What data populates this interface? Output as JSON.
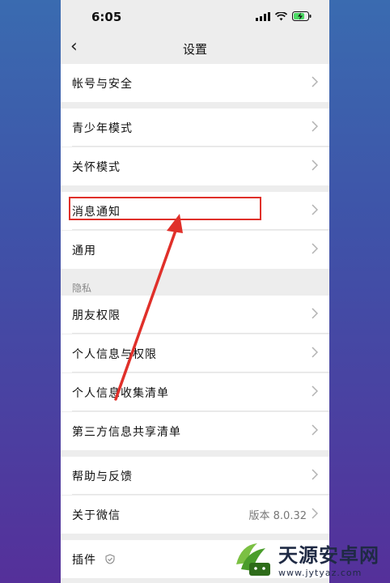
{
  "status": {
    "time": "6:05"
  },
  "navbar": {
    "title": "设置"
  },
  "rows": {
    "account": "帐号与安全",
    "teen": "青少年模式",
    "care": "关怀模式",
    "notify": "消息通知",
    "general": "通用",
    "friend_perm": "朋友权限",
    "personal_info": "个人信息与权限",
    "info_list": "个人信息收集清单",
    "third_party": "第三方信息共享清单",
    "help": "帮助与反馈",
    "about": "关于微信",
    "about_version": "版本 8.0.32",
    "plugins": "插件"
  },
  "sections": {
    "privacy": "隐私"
  },
  "colors": {
    "highlight": "#e0302a",
    "background": "#ededed"
  },
  "watermark": {
    "title": "天源安卓网",
    "url": "www.jytyaz.com"
  }
}
